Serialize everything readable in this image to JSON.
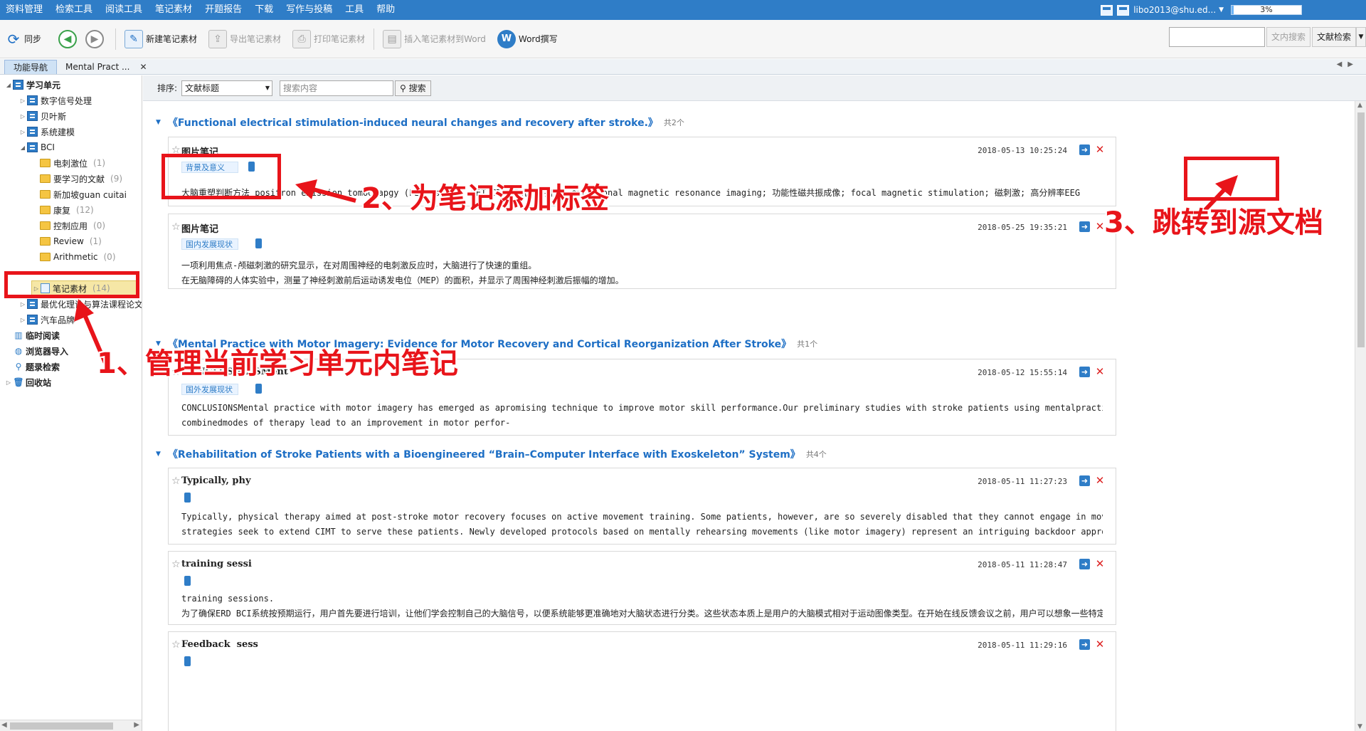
{
  "menubar": {
    "items": [
      "资料管理",
      "检索工具",
      "阅读工具",
      "笔记素材",
      "开题报告",
      "下载",
      "写作与投稿",
      "工具",
      "帮助"
    ],
    "user": "libo2013@shu.ed...",
    "progress_label": "3%",
    "progress_value": 0.03
  },
  "toolbar": {
    "sync": "同步",
    "new_note": "新建笔记素材",
    "export_note": "导出笔记素材",
    "print_note": "打印笔记素材",
    "insert_word": "插入笔记素材到Word",
    "word_write": "Word撰写",
    "search_in_doc": "文内搜索",
    "doc_search": "文献检索"
  },
  "tabs": {
    "nav": "功能导航",
    "doc": "Mental Pract ..."
  },
  "sidebar": {
    "root": "学习单元",
    "units": [
      "数字信号处理",
      "贝叶斯",
      "系统建模",
      "BCI"
    ],
    "bci_folders": [
      {
        "label": "电刺激位",
        "count": "(1)"
      },
      {
        "label": "要学习的文献",
        "count": "(9)"
      },
      {
        "label": "新加坡guan cuitai",
        "count": ""
      },
      {
        "label": "康复",
        "count": "(12)"
      },
      {
        "label": "控制应用",
        "count": "(0)"
      },
      {
        "label": "Review",
        "count": "(1)"
      },
      {
        "label": "Arithmetic",
        "count": "(0)"
      }
    ],
    "notes_item": {
      "label": "笔记素材",
      "count": "(14)"
    },
    "more_units": [
      "最优化理论与算法课程论文",
      "汽车品牌"
    ],
    "bottom": [
      "临时阅读",
      "浏览器导入",
      "题录检索",
      "回收站"
    ]
  },
  "sortbar": {
    "label": "排序:",
    "sort_value": "文献标题",
    "search_placeholder": "搜索内容",
    "search_button": "搜索"
  },
  "groups": [
    {
      "title": "《Functional electrical stimulation-induced neural changes and recovery after stroke.》",
      "count": "共2个"
    },
    {
      "title": "《Mental Practice with Motor Imagery: Evidence for Motor Recovery and Cortical Reorganization After Stroke》",
      "count": "共1个"
    },
    {
      "title": "《Rehabilitation of Stroke Patients with a Bioengineered “Brain–Computer Interface with Exoskeleton” System》",
      "count": "共4个"
    }
  ],
  "notes": [
    {
      "title": "图片笔记",
      "time": "2018-05-13 10:25:24",
      "tag": "背景及意义",
      "lines": [
        "大脑重塑判断方法 positron emission tomograpgy (PET) scans; PET/CT计算机断层扫描; functional magnetic resonance imaging; 功能性磁共振成像; focal magnetic stimulation; 磁刺激; 高分辨率EEG"
      ]
    },
    {
      "title": "图片笔记",
      "time": "2018-05-25 19:35:21",
      "tag": "国内发展现状",
      "lines": [
        "一项利用焦点-颅磁刺激的研究显示，在对周围神经的电刺激反应时，大脑进行了快速的重组。",
        "在无脑障碍的人体实验中，测量了神经刺激前后运动诱发电位（MEP）的面积，并显示了周围神经刺激后振幅的增加。"
      ]
    },
    {
      "title": "CONCLUSIONSMent",
      "time": "2018-05-12 15:55:14",
      "tag": "国外发展现状",
      "lines": [
        "CONCLUSIONSMental practice with motor imagery has emerged as apromising technique to improve motor skill performance.Our preliminary studies with stroke patients using mentalpractice in conjunction with PT suggest that these",
        "combinedmodes of therapy lead to an improvement in motor perfor-"
      ]
    },
    {
      "title": "Typically, phy",
      "time": "2018-05-11 11:27:23",
      "tag": "",
      "lines": [
        "Typically, physical therapy aimed at post-stroke motor recovery focuses on active movement training. Some patients, however, are so severely disabled that they cannot engage in movement without assistance. New rehabilitative",
        "strategies seek to extend CIMT to serve these patients. Newly developed protocols based on mentally rehearsing movements (like motor imagery) represent an intriguing backdoor approach to accessing the motor system because they"
      ]
    },
    {
      "title": "training sessi",
      "time": "2018-05-11 11:28:47",
      "tag": "",
      "lines": [
        "training sessions.",
        "为了确保ERD BCI系统按预期运行，用户首先要进行培训，让他们学会控制自己的大脑信号，以便系统能够更准确地对大脑状态进行分类。这些状态本质上是用户的大脑模式相对于运动图像类型。在开始在线反馈会议之前，用户可以想象一些特定身体部位的"
      ]
    },
    {
      "title": "Feedback  sess",
      "time": "2018-05-11 11:29:16",
      "tag": "",
      "lines": []
    }
  ],
  "annotations": {
    "a1": "1、管理当前学习单元内笔记",
    "a2": "2、为笔记添加标签",
    "a3": "3、跳转到源文档"
  }
}
